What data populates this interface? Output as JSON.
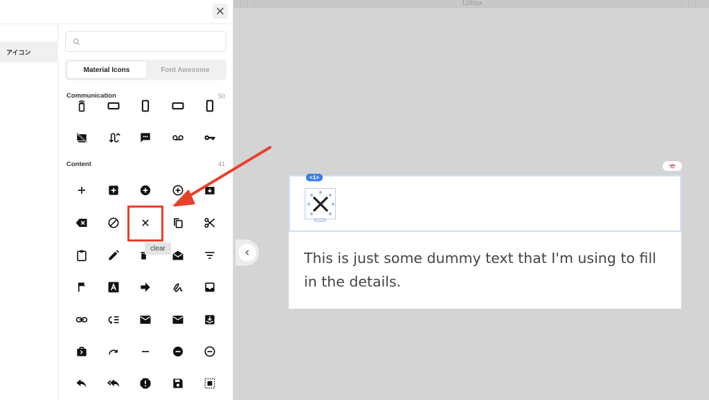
{
  "panel": {
    "nav_item": "アイコン",
    "search": {
      "placeholder": "",
      "value": ""
    },
    "tabs": [
      {
        "label": "Material Icons",
        "active": true
      },
      {
        "label": "Font Awesome",
        "active": false
      }
    ],
    "sections": [
      {
        "title": "Communication",
        "count": "50",
        "icons": [
          "phonelink-ring-icon",
          "stay-current-landscape-icon",
          "stay-current-portrait-icon",
          "stay-primary-landscape-icon",
          "stay-primary-portrait-icon",
          "stop-screen-share-icon",
          "swap-calls-icon",
          "textsms-icon",
          "voicemail-icon",
          "vpn-key-icon"
        ]
      },
      {
        "title": "Content",
        "count": "41",
        "icons": [
          "add-icon",
          "add-box-icon",
          "add-circle-icon",
          "add-circle-outline-icon",
          "archive-icon",
          "backspace-icon",
          "block-icon",
          "clear-icon",
          "content-copy-icon",
          "content-cut-icon",
          "content-paste-icon",
          "create-icon",
          "delete-sweep-icon",
          "drafts-icon",
          "filter-list-icon",
          "flag-icon",
          "font-download-icon",
          "forward-icon",
          "gesture-icon",
          "inbox-icon",
          "link-icon",
          "low-priority-icon",
          "mail-icon",
          "markunread-icon",
          "move-to-inbox-icon",
          "next-week-icon",
          "redo-icon",
          "remove-icon",
          "remove-circle-icon",
          "remove-circle-outline-icon",
          "reply-icon",
          "reply-all-icon",
          "report-icon",
          "save-icon",
          "select-all-icon"
        ]
      }
    ],
    "tooltip": "clear"
  },
  "canvas": {
    "ruler_label": "1280px",
    "code_badge": "<i>",
    "body_text": "This is just some dummy text that I'm using to fill in the details."
  },
  "colors": {
    "highlight": "#e8412b",
    "accent": "#3d7de8",
    "visibility": "#e24d8a"
  }
}
